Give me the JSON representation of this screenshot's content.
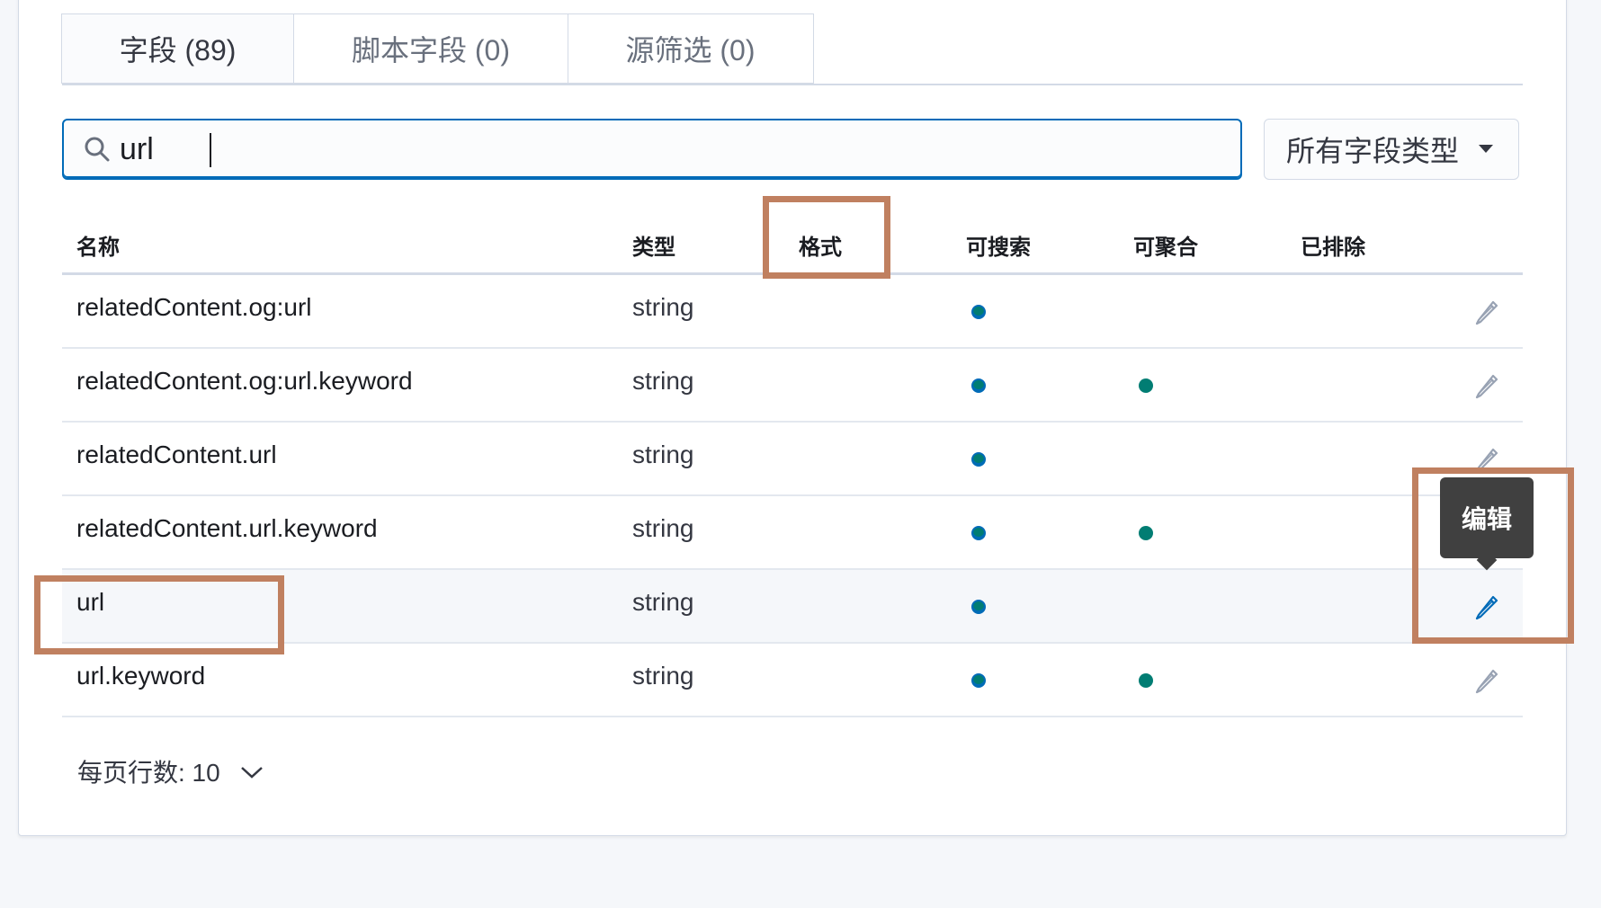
{
  "tabs": [
    {
      "label": "字段 (89)"
    },
    {
      "label": "脚本字段 (0)"
    },
    {
      "label": "源筛选 (0)"
    }
  ],
  "search": {
    "value": "url",
    "icon": "search-icon"
  },
  "type_filter": {
    "label": "所有字段类型"
  },
  "columns": {
    "name": "名称",
    "type": "类型",
    "format": "格式",
    "searchable": "可搜索",
    "aggregatable": "可聚合",
    "excluded": "已排除"
  },
  "rows": [
    {
      "name": "relatedContent.og:url",
      "type": "string",
      "searchable": true,
      "aggregatable": false
    },
    {
      "name": "relatedContent.og:url.keyword",
      "type": "string",
      "searchable": true,
      "aggregatable": true
    },
    {
      "name": "relatedContent.url",
      "type": "string",
      "searchable": true,
      "aggregatable": false
    },
    {
      "name": "relatedContent.url.keyword",
      "type": "string",
      "searchable": true,
      "aggregatable": true
    },
    {
      "name": "url",
      "type": "string",
      "searchable": true,
      "aggregatable": false
    },
    {
      "name": "url.keyword",
      "type": "string",
      "searchable": true,
      "aggregatable": true
    }
  ],
  "tooltip": {
    "label": "编辑"
  },
  "pagination": {
    "rows_per_page_label": "每页行数: 10"
  },
  "colors": {
    "accent": "#006bb8",
    "dot": "#017d73",
    "highlight": "#c08060"
  }
}
